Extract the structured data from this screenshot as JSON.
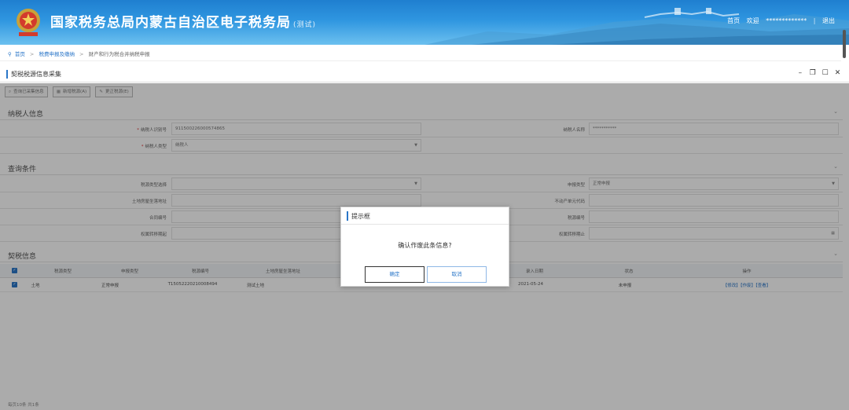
{
  "header": {
    "title": "国家税务总局内蒙古自治区电子税务局",
    "title_suffix": "(测试)",
    "links": {
      "home": "首页",
      "welcome": "欢迎",
      "user": "*************",
      "logout": "退出"
    }
  },
  "breadcrumb": {
    "home": "首页",
    "level1": "税费申报及缴纳",
    "level2": "财产和行为税合并纳税申报"
  },
  "panel": {
    "title": "契税税源信息采集"
  },
  "toolbar": {
    "query_label": "查询已采集信息",
    "add_label": "新增税源(A)",
    "modify_label": "更正税源(E)"
  },
  "taxpayer_section": {
    "title": "纳税人信息",
    "id_label": "纳税人识别号",
    "id_value": "911500226000574865",
    "name_label": "纳税人名称",
    "name_value": "***********",
    "type_label": "纳税人类型",
    "type_value": "纳税人"
  },
  "query_section": {
    "title": "查询条件",
    "source_type_label": "税源类型选择",
    "declare_type_label": "申报类型",
    "declare_type_value": "正常申报",
    "land_address_label": "土地房屋坐落地址",
    "realty_code_label": "不动产单元代码",
    "contract_label": "合同编号",
    "source_no_label": "税源编号",
    "period_start_label": "权属转移期起",
    "period_end_label": "权属转移期止"
  },
  "table": {
    "section_title": "契税信息",
    "headers": [
      "税源类型",
      "申报类型",
      "税源编号",
      "土地房屋坐落地址",
      "录入日期",
      "状态",
      "操作"
    ],
    "rows": [
      {
        "source_type": "土地",
        "declare_type": "正常申报",
        "source_no": "T15052220210008494",
        "address": "测试土地",
        "date": "2021-05-24",
        "status": "未申报",
        "actions": "【修改】【作废】【查看】"
      }
    ],
    "footer_left": "每页10条 共1条"
  },
  "dialog": {
    "title": "提示框",
    "message": "确认作废此条信息?",
    "ok_label": "确定",
    "cancel_label": "取消"
  }
}
